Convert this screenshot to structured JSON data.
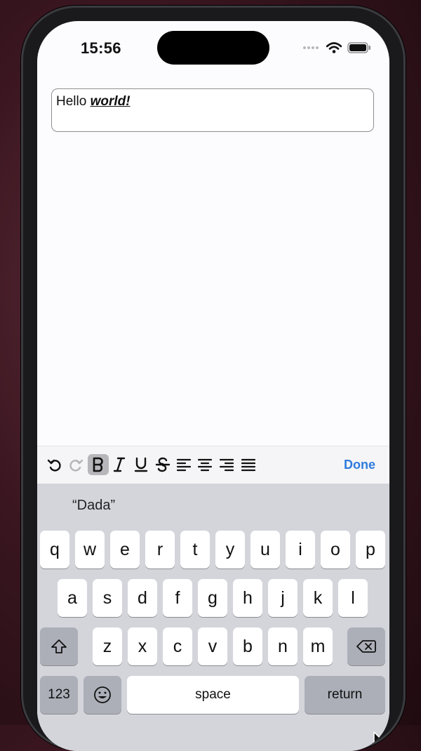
{
  "status_bar": {
    "time": "15:56"
  },
  "editor": {
    "text_plain": "Hello ",
    "text_styled": "world!"
  },
  "toolbar": {
    "buttons": [
      {
        "name": "undo",
        "icon": "undo-icon"
      },
      {
        "name": "redo",
        "icon": "redo-icon"
      },
      {
        "name": "bold",
        "icon": "bold-icon",
        "active": true
      },
      {
        "name": "italic",
        "icon": "italic-icon"
      },
      {
        "name": "underline",
        "icon": "underline-icon"
      },
      {
        "name": "strikethrough",
        "icon": "strikethrough-icon"
      },
      {
        "name": "align-left",
        "icon": "align-left-icon"
      },
      {
        "name": "align-center",
        "icon": "align-center-icon"
      },
      {
        "name": "align-right",
        "icon": "align-right-icon"
      },
      {
        "name": "justify",
        "icon": "justify-icon"
      }
    ],
    "done_label": "Done",
    "accent_color": "#2f7bdc"
  },
  "keyboard": {
    "suggestion": "“Dada”",
    "row1": [
      "q",
      "w",
      "e",
      "r",
      "t",
      "y",
      "u",
      "i",
      "o",
      "p"
    ],
    "row2": [
      "a",
      "s",
      "d",
      "f",
      "g",
      "h",
      "j",
      "k",
      "l"
    ],
    "row3": [
      "z",
      "x",
      "c",
      "v",
      "b",
      "n",
      "m"
    ],
    "numbers_label": "123",
    "space_label": "space",
    "return_label": "return"
  }
}
